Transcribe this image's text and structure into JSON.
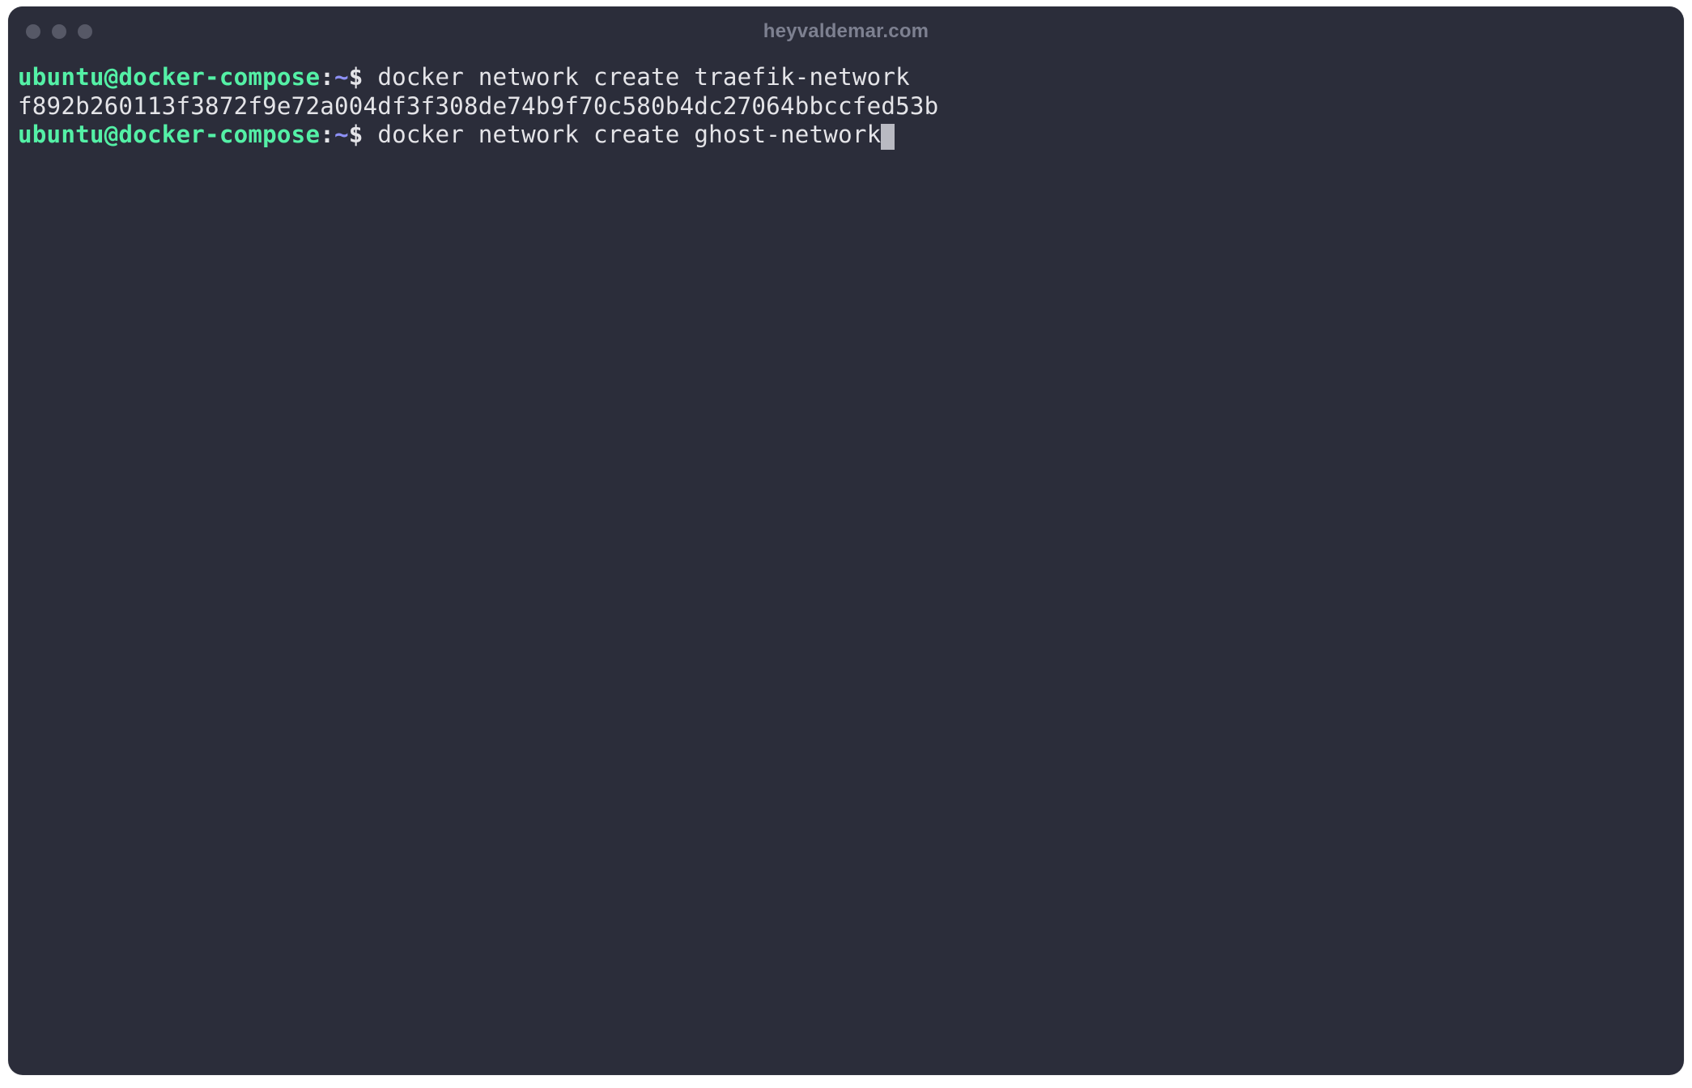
{
  "window": {
    "title": "heyvaldemar.com"
  },
  "prompt": {
    "user_host": "ubuntu@docker-compose",
    "colon": ":",
    "path": "~",
    "symbol": "$"
  },
  "lines": [
    {
      "type": "command",
      "command": "docker network create traefik-network"
    },
    {
      "type": "output",
      "text": "f892b260113f3872f9e72a004df3f308de74b9f70c580b4dc27064bbccfed53b"
    },
    {
      "type": "command",
      "command": "docker network create ghost-network",
      "cursor": true
    }
  ],
  "colors": {
    "background": "#2b2d3a",
    "prompt_green": "#54f0a6",
    "prompt_path": "#8d90f5",
    "text": "#e4e4e8",
    "title": "#7d8090",
    "cursor": "#b9bac2",
    "dots": "#565866"
  }
}
